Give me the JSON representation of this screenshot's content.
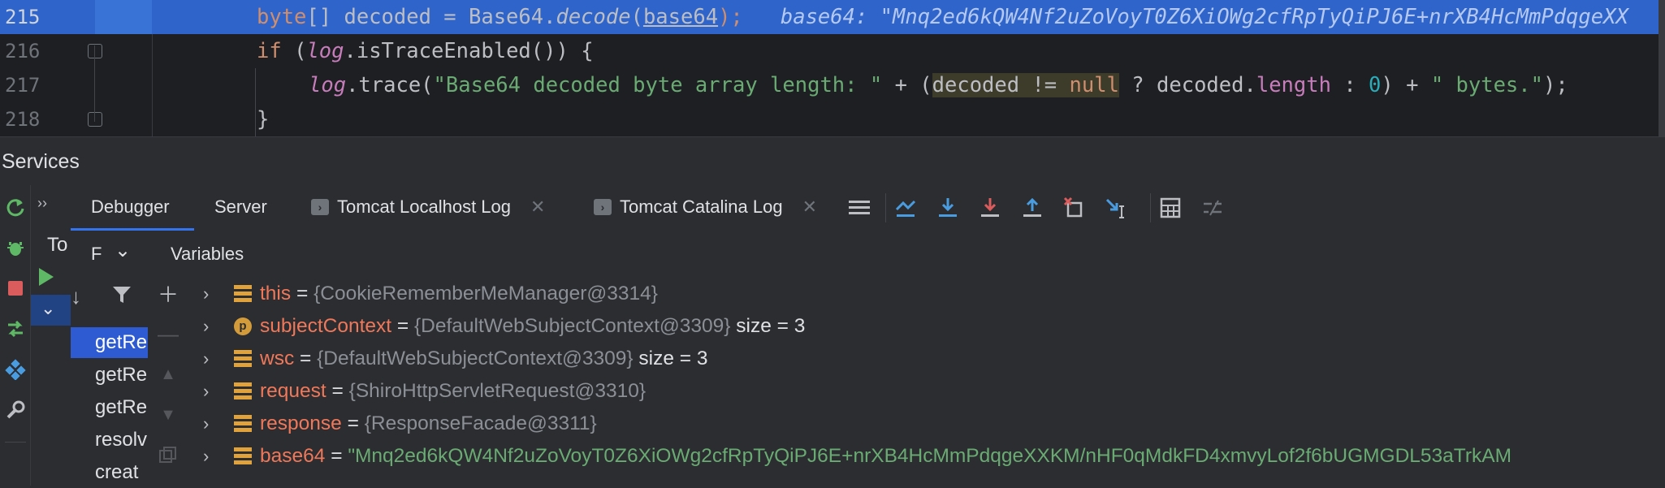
{
  "editor": {
    "lines": [
      {
        "num": "215",
        "content_parts": {
          "kw": "byte",
          "a": "[] decoded = Base64.",
          "fn": "decode",
          "b": "(",
          "arg": "base64",
          "c": ");",
          "inline": "base64: \"Mnq2ed6kQW4Nf2uZoVoyT0Z6XiOWg2cfRpTyQiPJ6E+nrXB4HcMmPdqgeXX"
        }
      },
      {
        "num": "216",
        "content_parts": {
          "kw": "if",
          "a": " (",
          "fld": "log",
          "b": ".isTraceEnabled()) {"
        }
      },
      {
        "num": "217",
        "content_parts": {
          "fld": "log",
          "a": ".trace(",
          "s1": "\"Base64 decoded byte array length: \"",
          "b": " + (",
          "h1": "decoded != ",
          "hkw": "null",
          "c": " ? decoded.",
          "len": "length",
          "d": " : ",
          "zero": "0",
          "e": ") + ",
          "s2": "\" bytes.\"",
          "f": ");"
        }
      },
      {
        "num": "218",
        "content_parts": {
          "a": "}"
        }
      }
    ]
  },
  "services": {
    "title": "Services"
  },
  "tree": {
    "peek": "To"
  },
  "tabs": [
    {
      "label": "Debugger"
    },
    {
      "label": "Server"
    },
    {
      "label": "Tomcat Localhost Log"
    },
    {
      "label": "Tomcat Catalina Log"
    }
  ],
  "frames_header": {
    "label": "F"
  },
  "variables_header": {
    "label": "Variables"
  },
  "frames": [
    "getRe",
    "getRe",
    "getRe",
    "resolv",
    "creat"
  ],
  "variables": [
    {
      "name": "this",
      "eq": " = ",
      "value": "{CookieRememberMeManager@3314}",
      "size": "",
      "icon": "field"
    },
    {
      "name": "subjectContext",
      "eq": " = ",
      "value": "{DefaultWebSubjectContext@3309}",
      "size": "size = 3",
      "icon": "param"
    },
    {
      "name": "wsc",
      "eq": " = ",
      "value": "{DefaultWebSubjectContext@3309}",
      "size": "size = 3",
      "icon": "field"
    },
    {
      "name": "request",
      "eq": " = ",
      "value": "{ShiroHttpServletRequest@3310}",
      "size": "",
      "icon": "field"
    },
    {
      "name": "response",
      "eq": " = ",
      "value": "{ResponseFacade@3311}",
      "size": "",
      "icon": "field"
    },
    {
      "name": "base64",
      "eq": " = ",
      "value": "\"Mnq2ed6kQW4Nf2uZoVoyT0Z6XiOWg2cfRpTyQiPJ6E+nrXB4HcMmPdqgeXXKM/nHF0qMdkFD4xmvyLof2f6bUGMGDL53aTrkAM",
      "size": "",
      "icon": "field",
      "string": true
    }
  ],
  "icons": {
    "rerun": "rerun-icon",
    "debug": "debug-icon",
    "stop": "stop-icon",
    "step": "step-icon",
    "services": "services-icon",
    "settings": "wrench-icon"
  },
  "colors": {
    "selection": "#2f65ca",
    "keyword": "#cf8e6d",
    "string": "#6aab73",
    "varname": "#f0785a"
  }
}
